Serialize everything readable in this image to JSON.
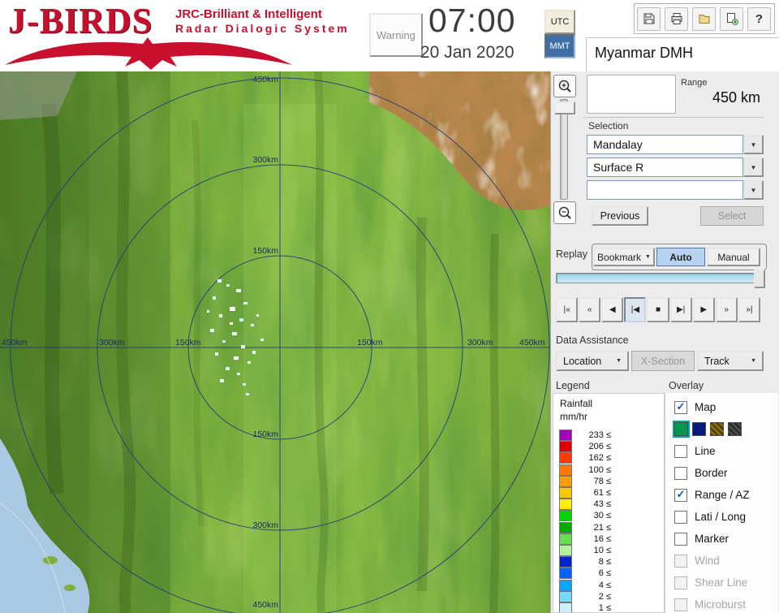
{
  "colors": {
    "brand-red": "#c8102e",
    "accent-blue": "#2f6db5",
    "selected-fill": "#b6d2f0"
  },
  "icons": {
    "dropdown": "▼",
    "check": "✓",
    "help": "?"
  },
  "header": {
    "logo_title": "J-BIRDS",
    "logo_sub1": "JRC-Brilliant & Intelligent",
    "logo_sub2": "Radar  Dialogic  System",
    "warning": "Warning",
    "time": "07:00",
    "date": "20 Jan 2020",
    "utc": "UTC",
    "mmt": "MMT",
    "org": "Myanmar DMH"
  },
  "map": {
    "ring_labels": {
      "r150": "150km",
      "r300": "300km",
      "r450": "450km"
    }
  },
  "panel": {
    "range_label": "Range",
    "range_value": "450 km",
    "selection_label": "Selection",
    "site": "Mandalay",
    "product": "Surface R",
    "product2": "",
    "previous": "Previous",
    "select": "Select",
    "replay": {
      "label": "Replay",
      "bookmark": "Bookmark",
      "auto": "Auto",
      "manual": "Manual",
      "buttons": [
        "|«",
        "«",
        "◀",
        "|◀",
        "■",
        "▶|",
        "▶",
        "»",
        "»|"
      ],
      "button_names": [
        "first",
        "fast-rewind",
        "step-back",
        "play-back",
        "stop",
        "step-forward",
        "play",
        "fast-forward",
        "last"
      ],
      "active_index": 3
    },
    "data_assistance": {
      "label": "Data Assistance",
      "location": "Location",
      "xsection": "X-Section",
      "track": "Track"
    },
    "legend": {
      "label": "Legend",
      "title1": "Rainfall",
      "title2": "mm/hr",
      "suffix": "≤",
      "entries": [
        {
          "value": "233",
          "color": "#a400b4"
        },
        {
          "value": "206",
          "color": "#dc0000"
        },
        {
          "value": "162",
          "color": "#ff3c00"
        },
        {
          "value": "100",
          "color": "#ff7800"
        },
        {
          "value": "78",
          "color": "#ffa000"
        },
        {
          "value": "61",
          "color": "#ffc800"
        },
        {
          "value": "43",
          "color": "#fff000"
        },
        {
          "value": "30",
          "color": "#00d400"
        },
        {
          "value": "21",
          "color": "#00aa00"
        },
        {
          "value": "16",
          "color": "#66dc50"
        },
        {
          "value": "10",
          "color": "#b4f0a0"
        },
        {
          "value": "8",
          "color": "#0028c8"
        },
        {
          "value": "6",
          "color": "#0064ff"
        },
        {
          "value": "4",
          "color": "#00a8ff"
        },
        {
          "value": "2",
          "color": "#78d8ff"
        },
        {
          "value": "1",
          "color": "#c8f0ff"
        }
      ]
    },
    "overlay": {
      "label": "Overlay",
      "items": [
        {
          "label": "Map",
          "checked": true
        },
        {
          "swatches": [
            {
              "color": "#009a4e",
              "selected": true
            },
            {
              "color": "#001a80"
            },
            {
              "color": "#8a7000",
              "hatch": true
            },
            {
              "color": "#4a4a4a",
              "hatch": true
            }
          ]
        },
        {
          "label": "Line",
          "checked": false
        },
        {
          "label": "Border",
          "checked": false
        },
        {
          "label": "Range / AZ",
          "checked": true
        },
        {
          "label": "Lati / Long",
          "checked": false
        },
        {
          "label": "Marker",
          "checked": false
        },
        {
          "label": "Wind",
          "checked": false,
          "disabled": true
        },
        {
          "label": "Shear Line",
          "checked": false,
          "disabled": true
        },
        {
          "label": "Microburst",
          "checked": false,
          "disabled": true
        }
      ]
    }
  }
}
